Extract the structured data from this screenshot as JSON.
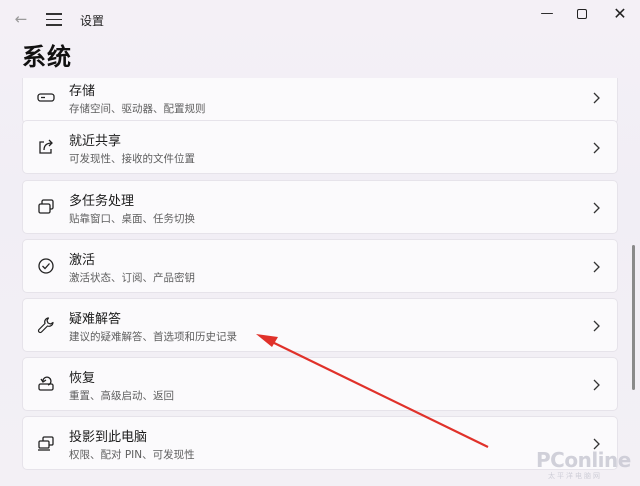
{
  "window": {
    "title": "设置",
    "back_glyph": "←",
    "minimize_glyph": "—",
    "close_glyph": "✕"
  },
  "page": {
    "title": "系统"
  },
  "items": [
    {
      "title": "存储",
      "subtitle": "存储空间、驱动器、配置规则",
      "icon": "storage-icon"
    },
    {
      "title": "就近共享",
      "subtitle": "可发现性、接收的文件位置",
      "icon": "share-icon"
    },
    {
      "title": "多任务处理",
      "subtitle": "贴靠窗口、桌面、任务切换",
      "icon": "multitasking-icon"
    },
    {
      "title": "激活",
      "subtitle": "激活状态、订阅、产品密钥",
      "icon": "activation-check-icon"
    },
    {
      "title": "疑难解答",
      "subtitle": "建议的疑难解答、首选项和历史记录",
      "icon": "wrench-icon"
    },
    {
      "title": "恢复",
      "subtitle": "重置、高级启动、返回",
      "icon": "recovery-icon"
    },
    {
      "title": "投影到此电脑",
      "subtitle": "权限、配对 PIN、可发现性",
      "icon": "project-icon"
    }
  ],
  "watermark": {
    "text": "PConline",
    "sub": "太平洋电脑网"
  },
  "colors": {
    "annotation_arrow": "#e0312a",
    "background": "#f3f0f6"
  }
}
